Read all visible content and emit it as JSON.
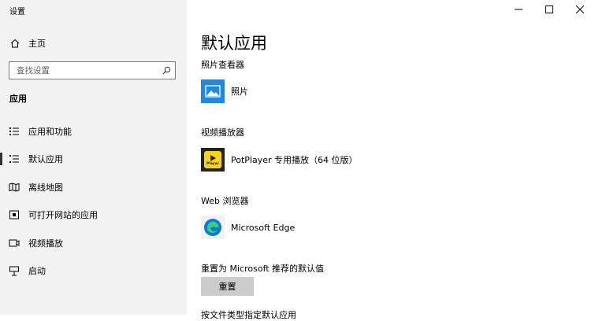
{
  "window": {
    "title": "设置"
  },
  "sidebar": {
    "home_label": "主页",
    "search": {
      "placeholder": "查找设置"
    },
    "section": "应用",
    "items": [
      {
        "label": "应用和功能",
        "icon": "apps-list-icon"
      },
      {
        "label": "默认应用",
        "icon": "default-apps-icon",
        "active": true
      },
      {
        "label": "离线地图",
        "icon": "offline-map-icon"
      },
      {
        "label": "可打开网站的应用",
        "icon": "open-website-icon"
      },
      {
        "label": "视频播放",
        "icon": "video-icon"
      },
      {
        "label": "启动",
        "icon": "startup-icon"
      }
    ]
  },
  "main": {
    "title": "默认应用",
    "categories": [
      {
        "label": "照片查看器",
        "app": "照片"
      },
      {
        "label": "视频播放器",
        "app": "PotPlayer 专用播放（64 位版）"
      },
      {
        "label": "Web 浏览器",
        "app": "Microsoft Edge"
      }
    ],
    "reset": {
      "label": "重置为 Microsoft 推荐的默认值",
      "button": "重置"
    },
    "cutoff_text": "按文件类型指定默认应用"
  },
  "icons": {
    "potplayer_badge": "Player"
  },
  "colors": {
    "photos": "#1e88e5",
    "potplayer_bg": "#222222",
    "potplayer_yellow": "#f7d417",
    "edge": "#0c7bd3"
  }
}
